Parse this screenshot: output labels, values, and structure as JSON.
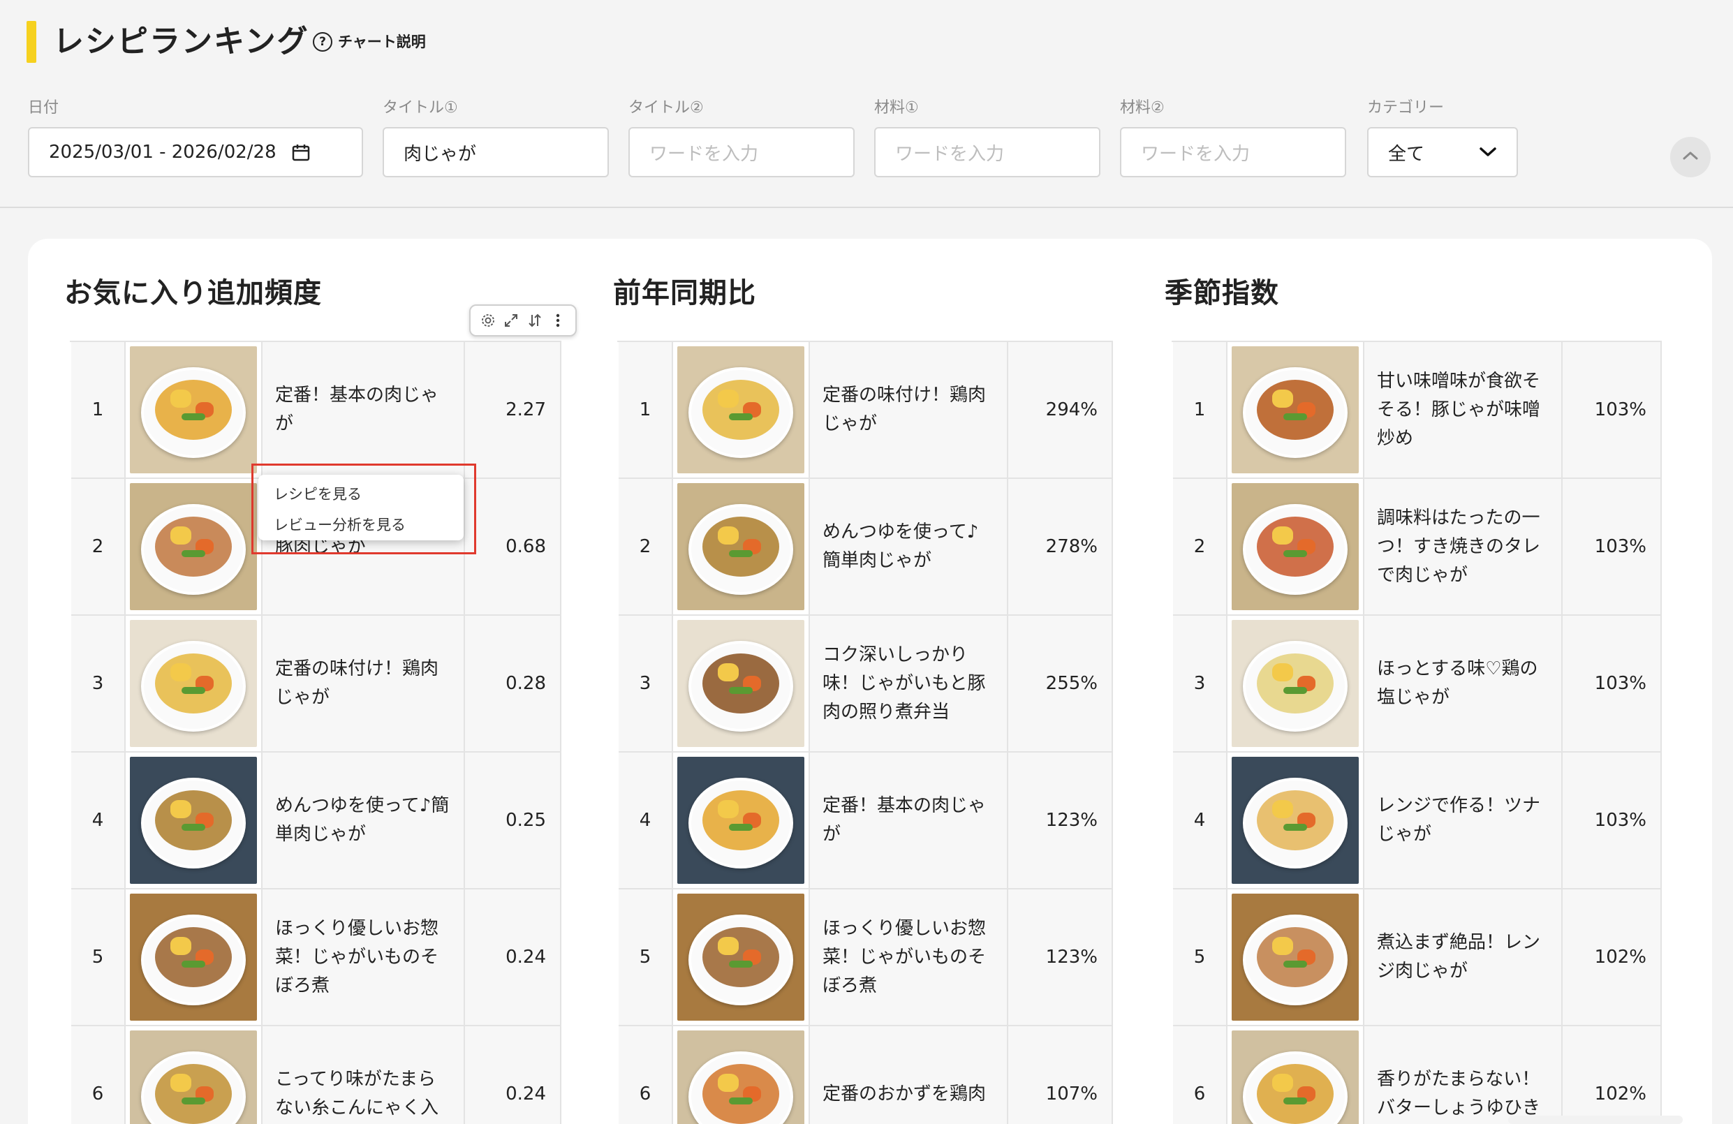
{
  "header": {
    "title": "レシピランキング",
    "help_label": "チャート説明",
    "filters": {
      "date": {
        "label": "日付",
        "value": "2025/03/01 - 2026/02/28"
      },
      "title1": {
        "label": "タイトル①",
        "value": "肉じゃが"
      },
      "title2": {
        "label": "タイトル②",
        "placeholder": "ワードを入力"
      },
      "ingredient1": {
        "label": "材料①",
        "placeholder": "ワードを入力"
      },
      "ingredient2": {
        "label": "材料②",
        "placeholder": "ワードを入力"
      },
      "category": {
        "label": "カテゴリー",
        "value": "全て"
      }
    }
  },
  "context_menu": {
    "items": [
      "レシピを見る",
      "レビュー分析を見る"
    ]
  },
  "sections": [
    {
      "title": "お気に入り追加頻度",
      "rows": [
        {
          "rank": "1",
          "name": "定番！基本の肉じゃが",
          "value": "2.27",
          "food": "#e8b24a"
        },
        {
          "rank": "2",
          "name": "豚肉じゃが",
          "value": "0.68",
          "food": "#c98a5a"
        },
        {
          "rank": "3",
          "name": "定番の味付け！鶏肉じゃが",
          "value": "0.28",
          "food": "#e9c25a"
        },
        {
          "rank": "4",
          "name": "めんつゆを使って♪簡単肉じゃが",
          "value": "0.25",
          "food": "#b8904a"
        },
        {
          "rank": "5",
          "name": "ほっくり優しいお惣菜！じゃがいものそぼろ煮",
          "value": "0.24",
          "food": "#a8784a"
        },
        {
          "rank": "6",
          "name": "こってり味がたまらない糸こんにゃく入",
          "value": "0.24",
          "food": "#c9a050"
        }
      ]
    },
    {
      "title": "前年同期比",
      "rows": [
        {
          "rank": "1",
          "name": "定番の味付け！鶏肉じゃが",
          "value": "294%",
          "food": "#e9c25a"
        },
        {
          "rank": "2",
          "name": "めんつゆを使って♪簡単肉じゃが",
          "value": "278%",
          "food": "#b8904a"
        },
        {
          "rank": "3",
          "name": "コク深いしっかり味！じゃがいもと豚肉の照り煮弁当",
          "value": "255%",
          "food": "#9a6a40"
        },
        {
          "rank": "4",
          "name": "定番！基本の肉じゃが",
          "value": "123%",
          "food": "#e8b24a"
        },
        {
          "rank": "5",
          "name": "ほっくり優しいお惣菜！じゃがいものそぼろ煮",
          "value": "123%",
          "food": "#a8784a"
        },
        {
          "rank": "6",
          "name": "定番のおかずを鶏肉",
          "value": "107%",
          "food": "#d98a4a"
        }
      ]
    },
    {
      "title": "季節指数",
      "rows": [
        {
          "rank": "1",
          "name": "甘い味噌味が食欲そそる！豚じゃが味噌炒め",
          "value": "103%",
          "food": "#c0703a"
        },
        {
          "rank": "2",
          "name": "調味料はたったの一つ！すき焼きのタレで肉じゃが",
          "value": "103%",
          "food": "#d0704a"
        },
        {
          "rank": "3",
          "name": "ほっとする味♡鶏の塩じゃが",
          "value": "103%",
          "food": "#e8d890"
        },
        {
          "rank": "4",
          "name": "レンジで作る！ツナじゃが",
          "value": "103%",
          "food": "#e8c070"
        },
        {
          "rank": "5",
          "name": "煮込まず絶品！レンジ肉じゃが",
          "value": "102%",
          "food": "#c89060"
        },
        {
          "rank": "6",
          "name": "香りがたまらない！バターしょうゆひき",
          "value": "102%",
          "food": "#e0b050"
        }
      ]
    }
  ],
  "colors": {
    "accent_bar": "#f6d11f",
    "menu_highlight": "#e03a2e"
  }
}
